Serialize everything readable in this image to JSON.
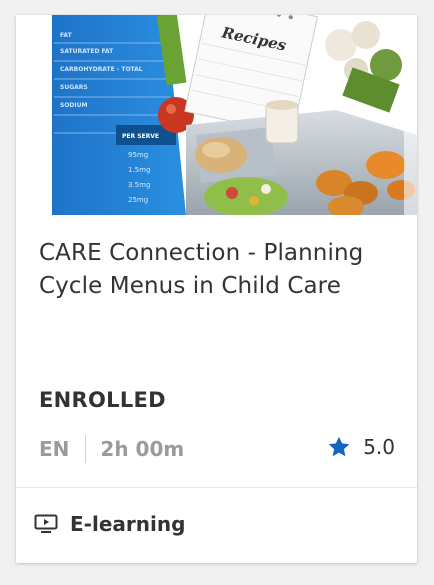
{
  "course": {
    "title": "CARE Connection - Planning Cycle Menus in Child Care",
    "status": "ENROLLED",
    "language": "EN",
    "duration": "2h 00m",
    "rating": "5.0",
    "type_label": "E-learning",
    "type_icon": "video-screen-icon",
    "rating_icon": "star-icon"
  },
  "thumbnail": {
    "recipes_label": "Recipes",
    "nutrition_rows": [
      "FAT",
      "SATURATED FAT",
      "CARBOHYDRATE - TOTAL",
      "SUGARS",
      "SODIUM"
    ],
    "per_serve_label": "PER SERVE",
    "values": [
      "95mg",
      "1.5mg",
      "3.5mg",
      "25mg"
    ]
  },
  "colors": {
    "star": "#1565c0",
    "text": "#333333",
    "muted": "#9b9b9b"
  }
}
